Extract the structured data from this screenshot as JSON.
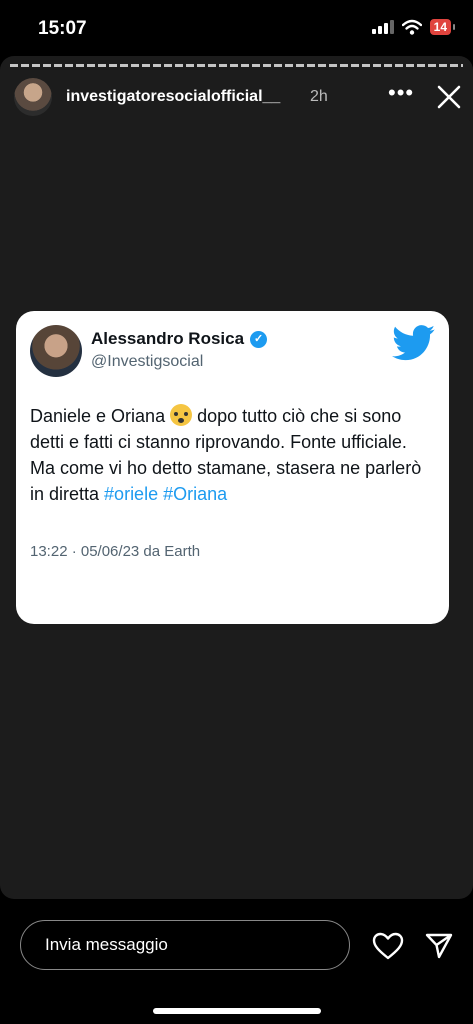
{
  "status_bar": {
    "time": "15:07",
    "battery": "14"
  },
  "story": {
    "username": "investigatoresocialofficial__",
    "time_ago": "2h"
  },
  "tweet": {
    "author": "Alessandro Rosica",
    "handle": "@Investigsocial",
    "text_part1": "Daniele e Oriana ",
    "text_part2": " dopo tutto ciò che si sono detti e fatti ci stanno riprovando. Fonte ufficiale. Ma come vi ho detto stamane, stasera ne parlerò in diretta ",
    "hashtag1": "#oriele",
    "hashtag2": "#Oriana",
    "meta": "13:22 · 05/06/23 da Earth"
  },
  "reply": {
    "placeholder": "Invia messaggio"
  },
  "colors": {
    "twitter_blue": "#1d9bf0",
    "battery_red": "#e0443e"
  },
  "icons": [
    "signal-icon",
    "wifi-icon",
    "battery-icon",
    "more-icon",
    "close-icon",
    "verified-icon",
    "twitter-bird-icon",
    "heart-icon",
    "send-icon"
  ]
}
